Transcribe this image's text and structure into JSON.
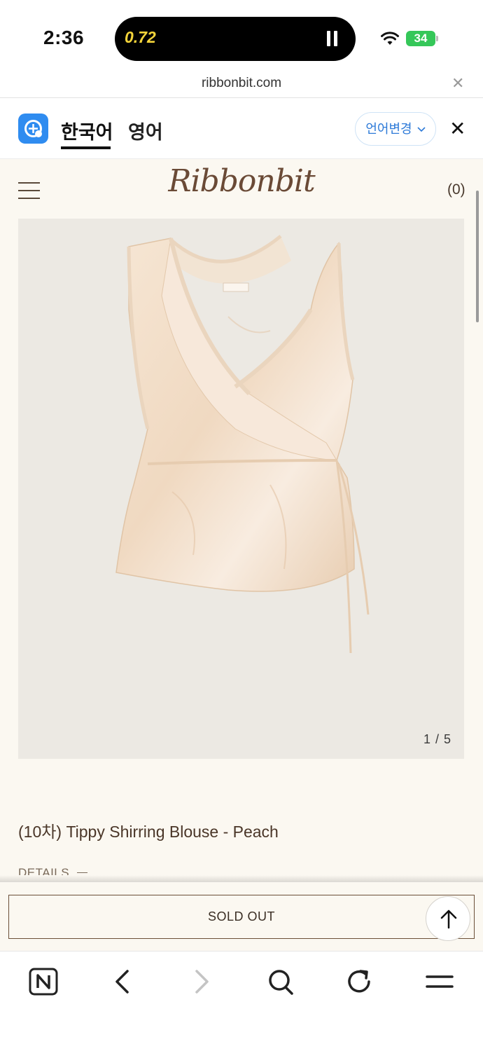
{
  "status_bar": {
    "time": "2:36",
    "island_value": "0.72",
    "battery": "34"
  },
  "browser": {
    "url": "ribbonbit.com"
  },
  "translate_bar": {
    "tabs": [
      "한국어",
      "영어"
    ],
    "active_tab": "한국어",
    "change_language_label": "언어변경"
  },
  "shop": {
    "brand": "Ribbonbit",
    "cart_count": "(0)",
    "image_counter": "1 / 5",
    "product_title": "(10차) Tippy Shirring Blouse - Peach",
    "details_label": "DETAILS",
    "sold_out_label": "SOLD OUT"
  },
  "nav": {
    "items": [
      "naver-home-icon",
      "back-icon",
      "forward-icon",
      "search-icon",
      "refresh-icon",
      "menu-icon"
    ]
  },
  "colors": {
    "page_background": "#fbf8f1",
    "brand_brown": "#6a4a36",
    "translate_blue": "#2f8cf0",
    "battery_green": "#35c759"
  }
}
